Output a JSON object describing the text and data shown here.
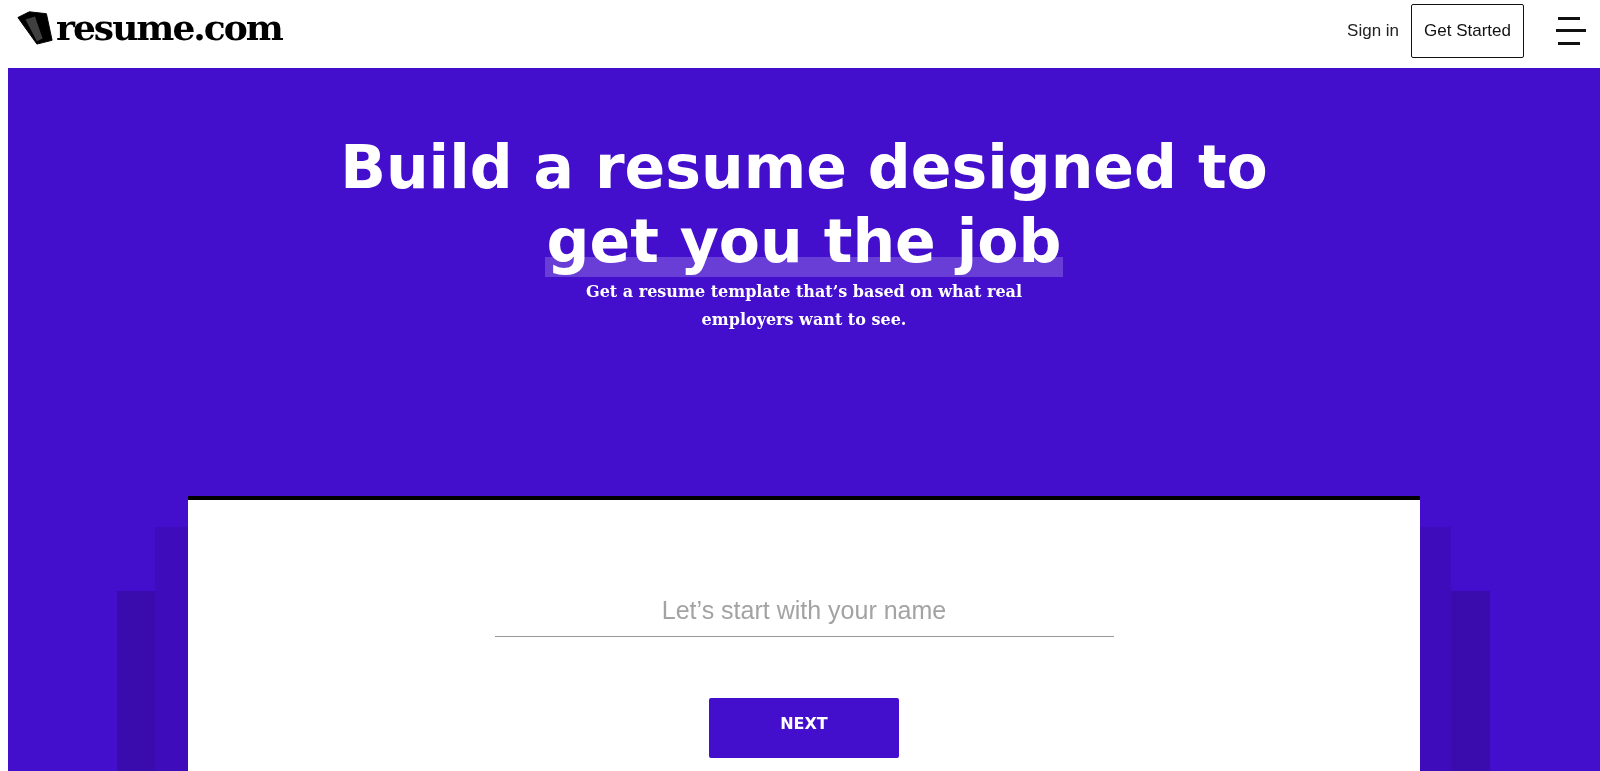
{
  "header": {
    "logo": "resume.com",
    "nav_links": [
      {
        "label": "Sign in"
      }
    ],
    "cta": "Get Started"
  },
  "hero": {
    "headline_lines": [
      {
        "text": "Build a resume designed to",
        "highlighted": false
      },
      {
        "text": "get you the job",
        "highlighted": true
      }
    ],
    "subtitle": "Get a resume template that’s based on what real employers want to see."
  },
  "form": {
    "name_field": {
      "placeholder": "Let’s start with your name"
    },
    "button": "NEXT"
  }
}
